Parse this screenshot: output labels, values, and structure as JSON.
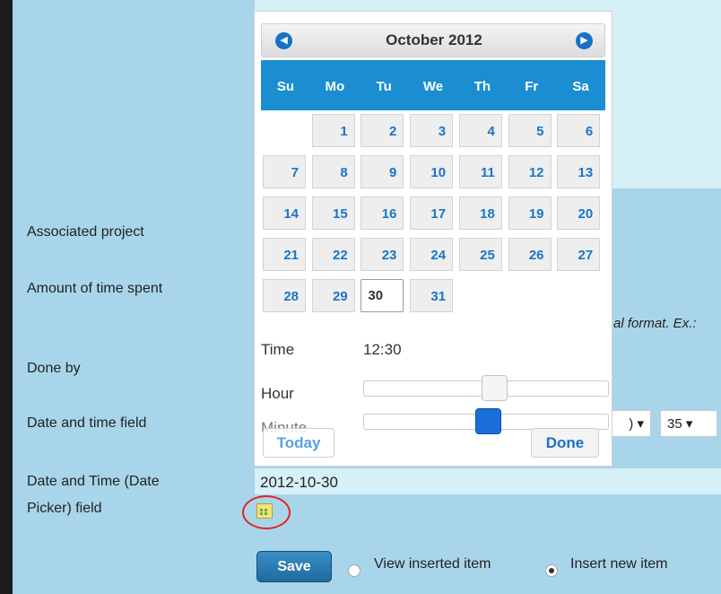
{
  "form": {
    "labels": {
      "associated_project": "Associated project",
      "amount_time": "Amount of time spent",
      "done_by": "Done by",
      "date_time_field": "Date and time field",
      "dt_picker_line1": "Date and Time (Date",
      "dt_picker_line2": "Picker) field"
    },
    "time_hint": "al format. Ex.:",
    "hour_select_fragment": ") ▾",
    "minute_select": "35 ▾",
    "date_value": "2012-10-30",
    "save_label": "Save",
    "radio_view": "View inserted item",
    "radio_insert": "Insert new item",
    "selected_radio": "insert"
  },
  "datepicker": {
    "month_title": "October 2012",
    "prev_icon": "chevron-left-circle-icon",
    "next_icon": "chevron-right-circle-icon",
    "weekdays": [
      "Su",
      "Mo",
      "Tu",
      "We",
      "Th",
      "Fr",
      "Sa"
    ],
    "days": [
      "1",
      "2",
      "3",
      "4",
      "5",
      "6",
      "7",
      "8",
      "9",
      "10",
      "11",
      "12",
      "13",
      "14",
      "15",
      "16",
      "17",
      "18",
      "19",
      "20",
      "21",
      "22",
      "23",
      "24",
      "25",
      "26",
      "27",
      "28",
      "29",
      "30",
      "31"
    ],
    "first_weekday_index": 1,
    "selected_day": "30",
    "time_label": "Time",
    "time_value": "12:30",
    "hour_label": "Hour",
    "minute_label": "Minute",
    "hour_value": 12,
    "minute_value": 30,
    "today_label": "Today",
    "done_label": "Done",
    "colors": {
      "accent": "#1a8ed0",
      "day_text": "#1a75c7",
      "minute_handle": "#1a6fd8"
    }
  }
}
